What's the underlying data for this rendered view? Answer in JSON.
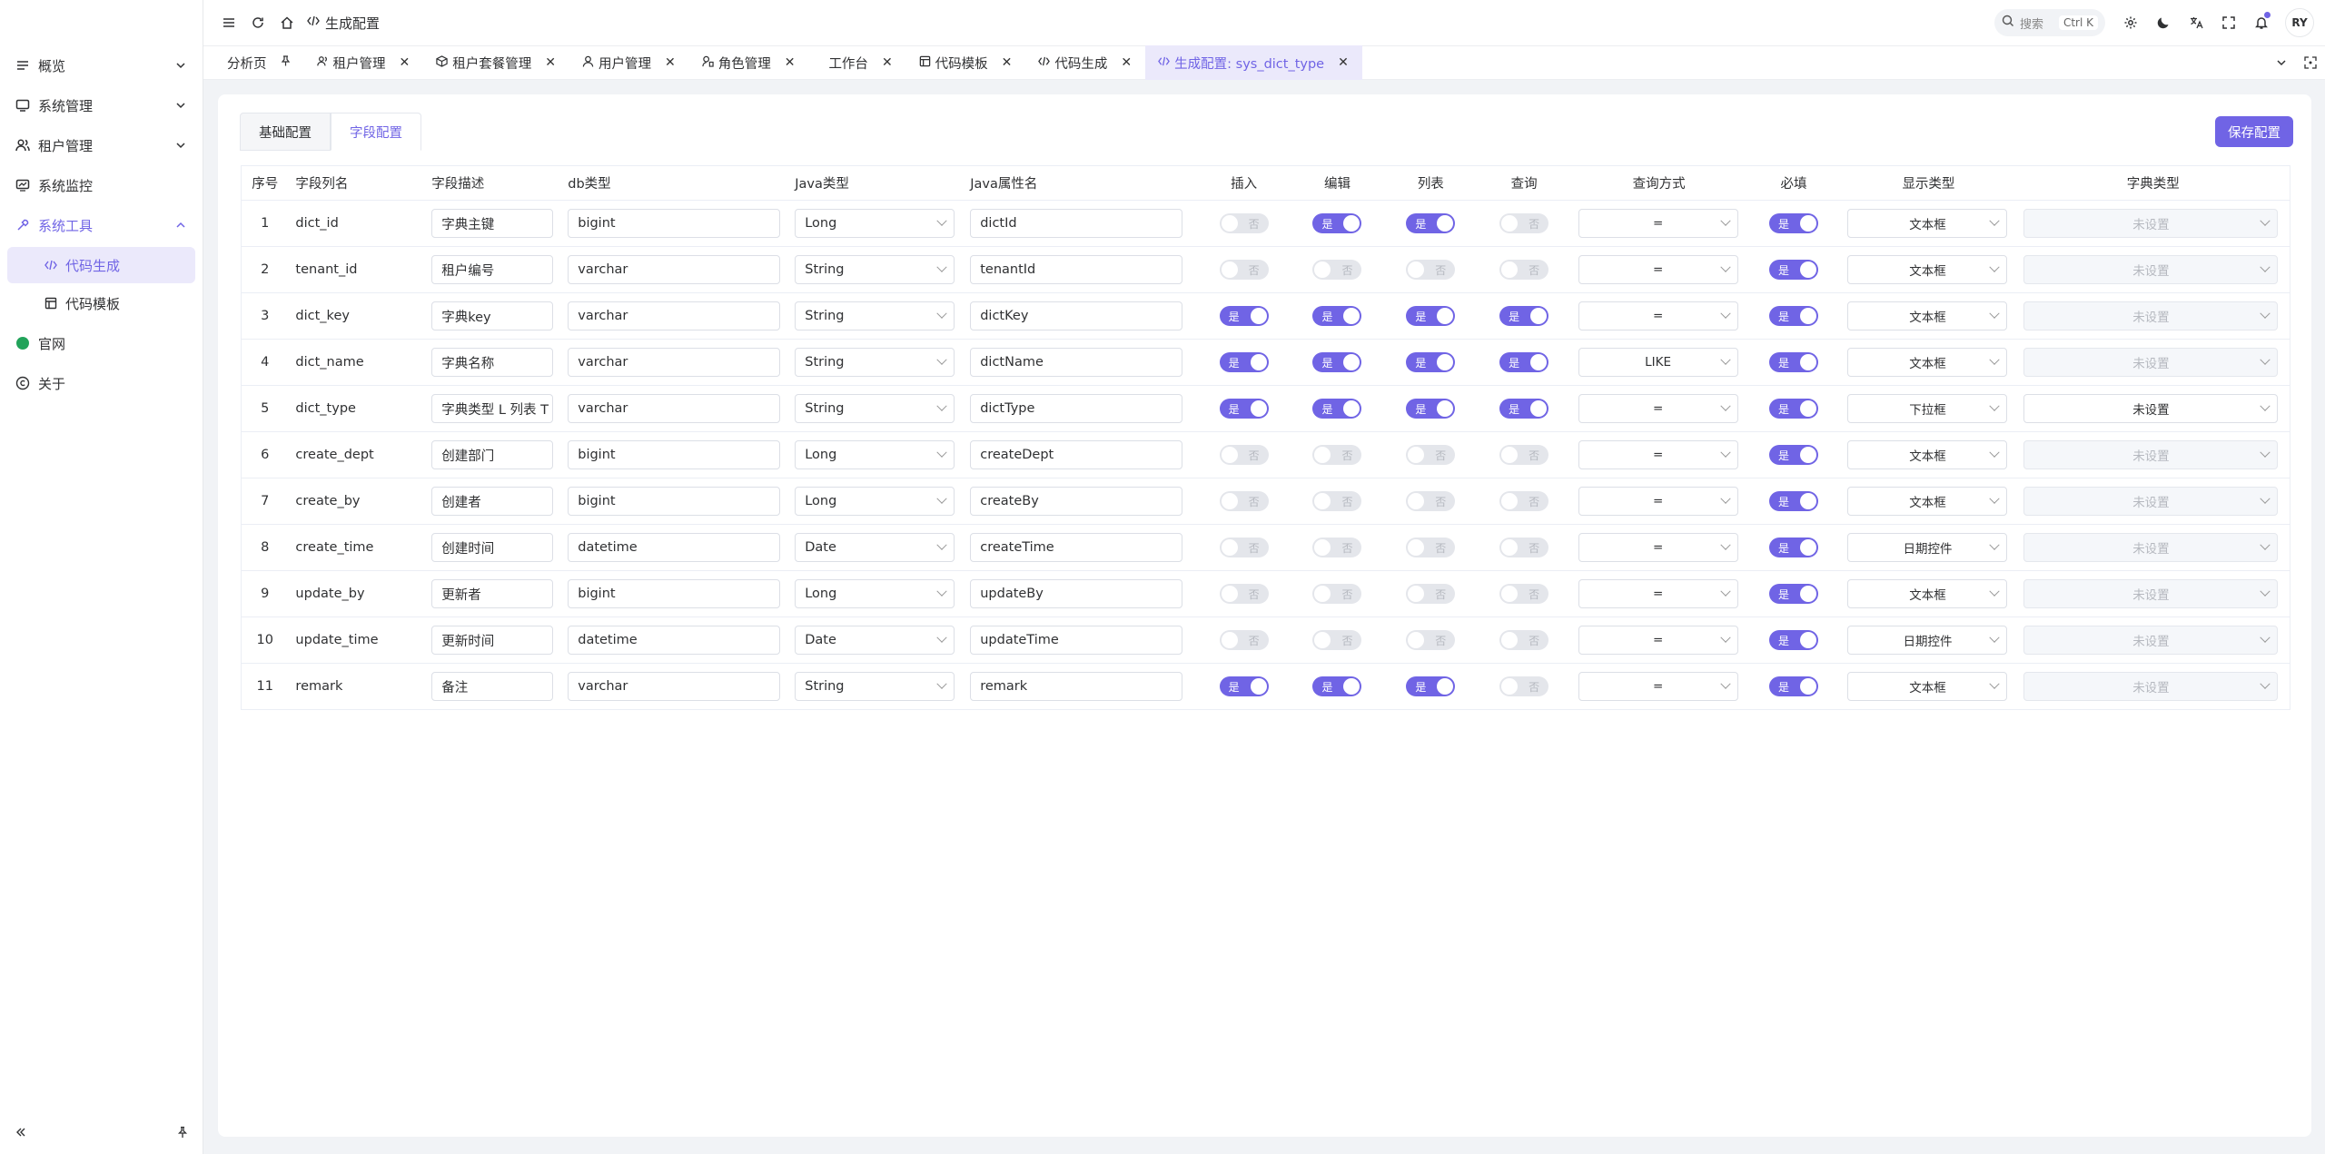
{
  "sidebar": {
    "items": [
      {
        "label": "概览",
        "icon": "dashboard-icon"
      },
      {
        "label": "系统管理",
        "icon": "monitor-settings-icon"
      },
      {
        "label": "租户管理",
        "icon": "users-icon"
      },
      {
        "label": "系统监控",
        "icon": "monitor-icon"
      },
      {
        "label": "系统工具",
        "icon": "tool-icon"
      },
      {
        "label": "代码生成",
        "icon": "code-icon"
      },
      {
        "label": "代码模板",
        "icon": "template-icon"
      },
      {
        "label": "官网",
        "icon": "website-icon"
      },
      {
        "label": "关于",
        "icon": "copyright-icon"
      }
    ]
  },
  "header": {
    "breadcrumb": "生成配置",
    "search_label": "搜索",
    "search_shortcut": "Ctrl K",
    "avatar": "RY"
  },
  "tabs": [
    {
      "label": "分析页"
    },
    {
      "label": "租户管理"
    },
    {
      "label": "租户套餐管理"
    },
    {
      "label": "用户管理"
    },
    {
      "label": "角色管理"
    },
    {
      "label": "工作台"
    },
    {
      "label": "代码模板"
    },
    {
      "label": "代码生成"
    },
    {
      "label": "生成配置: sys_dict_type"
    }
  ],
  "page": {
    "subtab_basic": "基础配置",
    "subtab_fields": "字段配置",
    "save_label": "保存配置"
  },
  "table": {
    "headers": [
      "序号",
      "字段列名",
      "字段描述",
      "db类型",
      "Java类型",
      "Java属性名",
      "插入",
      "编辑",
      "列表",
      "查询",
      "查询方式",
      "必填",
      "显示类型",
      "字典类型"
    ],
    "on_label": "是",
    "off_label": "否",
    "rows": [
      {
        "no": "1",
        "col": "dict_id",
        "desc": "字典主键",
        "db": "bigint",
        "java": "Long",
        "prop": "dictId",
        "insert": false,
        "edit": true,
        "list": true,
        "query": false,
        "qtype": "=",
        "required": true,
        "display": "文本框",
        "dict": "未设置",
        "dict_enabled": false
      },
      {
        "no": "2",
        "col": "tenant_id",
        "desc": "租户编号",
        "db": "varchar",
        "java": "String",
        "prop": "tenantId",
        "insert": false,
        "edit": false,
        "list": false,
        "query": false,
        "qtype": "=",
        "required": true,
        "display": "文本框",
        "dict": "未设置",
        "dict_enabled": false
      },
      {
        "no": "3",
        "col": "dict_key",
        "desc": "字典key",
        "db": "varchar",
        "java": "String",
        "prop": "dictKey",
        "insert": true,
        "edit": true,
        "list": true,
        "query": true,
        "qtype": "=",
        "required": true,
        "display": "文本框",
        "dict": "未设置",
        "dict_enabled": false
      },
      {
        "no": "4",
        "col": "dict_name",
        "desc": "字典名称",
        "db": "varchar",
        "java": "String",
        "prop": "dictName",
        "insert": true,
        "edit": true,
        "list": true,
        "query": true,
        "qtype": "LIKE",
        "required": true,
        "display": "文本框",
        "dict": "未设置",
        "dict_enabled": false
      },
      {
        "no": "5",
        "col": "dict_type",
        "desc": "字典类型 L 列表 T",
        "db": "varchar",
        "java": "String",
        "prop": "dictType",
        "insert": true,
        "edit": true,
        "list": true,
        "query": true,
        "qtype": "=",
        "required": true,
        "display": "下拉框",
        "dict": "未设置",
        "dict_enabled": true
      },
      {
        "no": "6",
        "col": "create_dept",
        "desc": "创建部门",
        "db": "bigint",
        "java": "Long",
        "prop": "createDept",
        "insert": false,
        "edit": false,
        "list": false,
        "query": false,
        "qtype": "=",
        "required": true,
        "display": "文本框",
        "dict": "未设置",
        "dict_enabled": false
      },
      {
        "no": "7",
        "col": "create_by",
        "desc": "创建者",
        "db": "bigint",
        "java": "Long",
        "prop": "createBy",
        "insert": false,
        "edit": false,
        "list": false,
        "query": false,
        "qtype": "=",
        "required": true,
        "display": "文本框",
        "dict": "未设置",
        "dict_enabled": false
      },
      {
        "no": "8",
        "col": "create_time",
        "desc": "创建时间",
        "db": "datetime",
        "java": "Date",
        "prop": "createTime",
        "insert": false,
        "edit": false,
        "list": false,
        "query": false,
        "qtype": "=",
        "required": true,
        "display": "日期控件",
        "dict": "未设置",
        "dict_enabled": false
      },
      {
        "no": "9",
        "col": "update_by",
        "desc": "更新者",
        "db": "bigint",
        "java": "Long",
        "prop": "updateBy",
        "insert": false,
        "edit": false,
        "list": false,
        "query": false,
        "qtype": "=",
        "required": true,
        "display": "文本框",
        "dict": "未设置",
        "dict_enabled": false
      },
      {
        "no": "10",
        "col": "update_time",
        "desc": "更新时间",
        "db": "datetime",
        "java": "Date",
        "prop": "updateTime",
        "insert": false,
        "edit": false,
        "list": false,
        "query": false,
        "qtype": "=",
        "required": true,
        "display": "日期控件",
        "dict": "未设置",
        "dict_enabled": false
      },
      {
        "no": "11",
        "col": "remark",
        "desc": "备注",
        "db": "varchar",
        "java": "String",
        "prop": "remark",
        "insert": true,
        "edit": true,
        "list": true,
        "query": false,
        "qtype": "=",
        "required": true,
        "display": "文本框",
        "dict": "未设置",
        "dict_enabled": false
      }
    ]
  },
  "colors": {
    "accent": "#7064e5",
    "accent_light": "#ebe9fb",
    "official": "#22a35a"
  }
}
